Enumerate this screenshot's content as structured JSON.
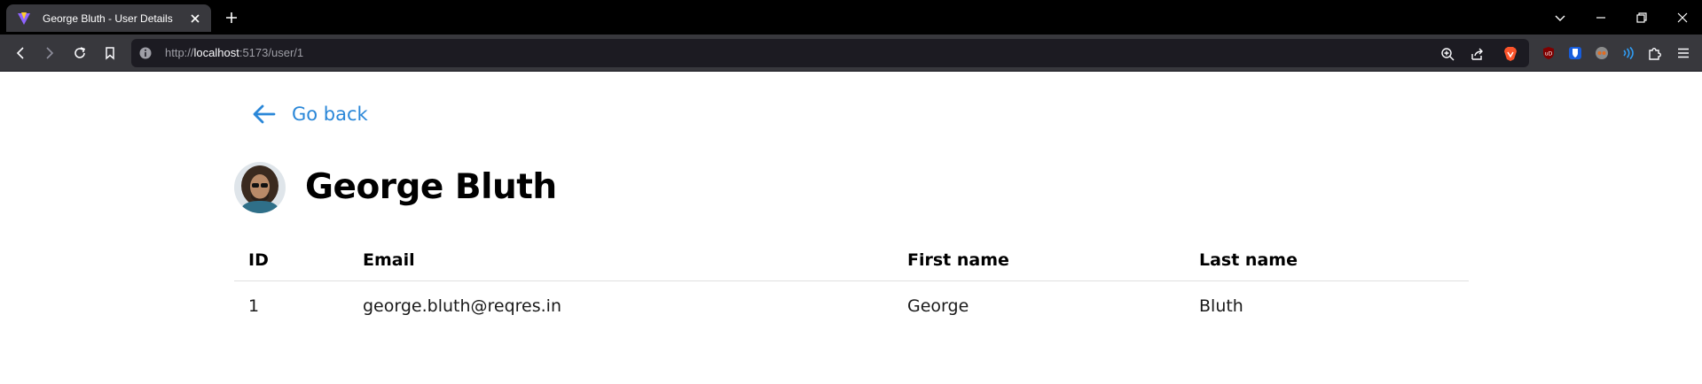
{
  "browser": {
    "tab": {
      "title": "George Bluth - User Details"
    },
    "address": {
      "scheme": "http://",
      "host": "localhost",
      "rest": ":5173/user/1"
    }
  },
  "colors": {
    "link": "#2a87d8",
    "tab_bg": "#38383d",
    "url_bg": "#1c1b22"
  },
  "page": {
    "back_label": "Go back",
    "title": "George Bluth",
    "table": {
      "headers": {
        "id": "ID",
        "email": "Email",
        "first_name": "First name",
        "last_name": "Last name"
      },
      "row": {
        "id": "1",
        "email": "george.bluth@reqres.in",
        "first_name": "George",
        "last_name": "Bluth"
      }
    }
  }
}
